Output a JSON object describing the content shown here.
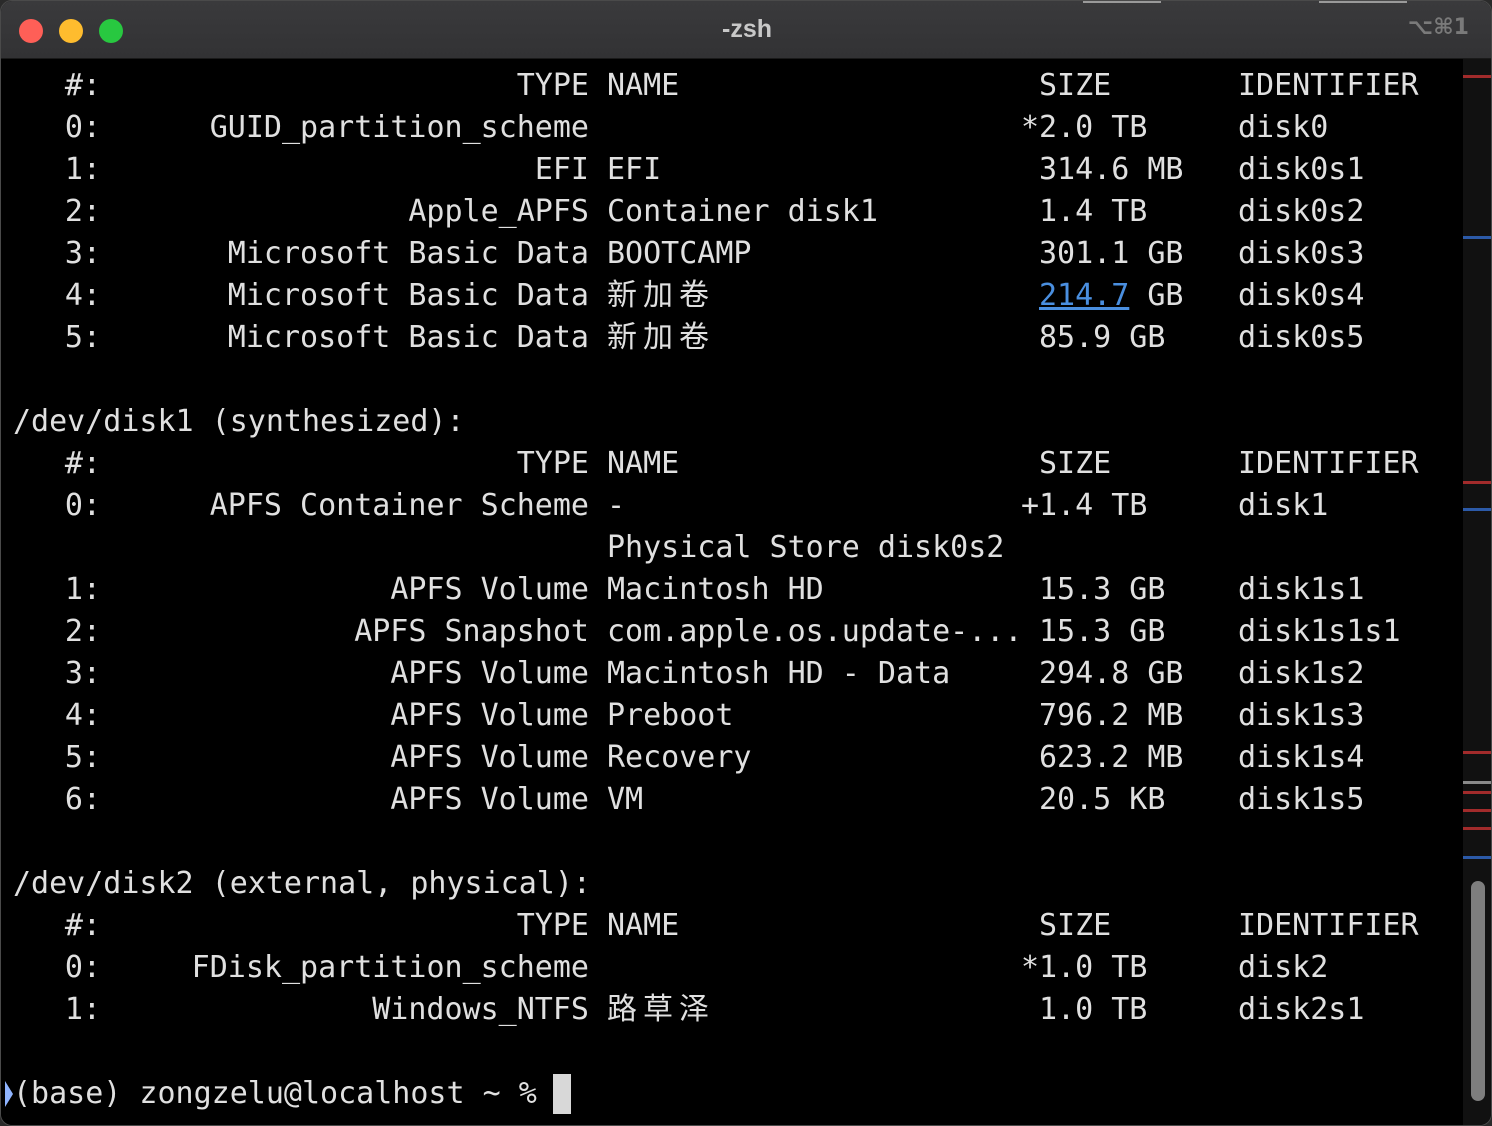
{
  "window": {
    "title": "-zsh",
    "shortcut": "⌥⌘1"
  },
  "lines": [
    {
      "id": "disk0-header",
      "num": "#:",
      "type": "TYPE",
      "name": "NAME",
      "size": "SIZE",
      "identifier": "IDENTIFIER"
    },
    {
      "id": "disk0-row0",
      "num": "0:",
      "type": "GUID_partition_scheme",
      "name": "",
      "size": "*2.0 TB",
      "identifier": "disk0"
    },
    {
      "id": "disk0-row1",
      "num": "1:",
      "type": "EFI",
      "name": "EFI",
      "size": "314.6 MB",
      "identifier": "disk0s1"
    },
    {
      "id": "disk0-row2",
      "num": "2:",
      "type": "Apple_APFS",
      "name": "Container disk1",
      "size": "1.4 TB",
      "identifier": "disk0s2"
    },
    {
      "id": "disk0-row3",
      "num": "3:",
      "type": "Microsoft Basic Data",
      "name": "BOOTCAMP",
      "size": "301.1 GB",
      "identifier": "disk0s3"
    },
    {
      "id": "disk0-row4",
      "num": "4:",
      "type": "Microsoft Basic Data",
      "name": "新加卷",
      "size": "214.7 GB",
      "size_value": "214.7",
      "size_unit": "GB",
      "identifier": "disk0s4",
      "size_link": true
    },
    {
      "id": "disk0-row5",
      "num": "5:",
      "type": "Microsoft Basic Data",
      "name": "新加卷",
      "size": "85.9 GB",
      "identifier": "disk0s5"
    },
    {
      "id": "disk1-title",
      "text": "/dev/disk1 (synthesized):"
    },
    {
      "id": "disk1-header",
      "num": "#:",
      "type": "TYPE",
      "name": "NAME",
      "size": "SIZE",
      "identifier": "IDENTIFIER"
    },
    {
      "id": "disk1-row0",
      "num": "0:",
      "type": "APFS Container Scheme",
      "name": "-",
      "size": "+1.4 TB",
      "identifier": "disk1"
    },
    {
      "id": "disk1-row0b",
      "num": "",
      "type": "",
      "name": "Physical Store disk0s2",
      "size": "",
      "identifier": ""
    },
    {
      "id": "disk1-row1",
      "num": "1:",
      "type": "APFS Volume",
      "name": "Macintosh HD",
      "size": "15.3 GB",
      "identifier": "disk1s1"
    },
    {
      "id": "disk1-row2",
      "num": "2:",
      "type": "APFS Snapshot",
      "name": "com.apple.os.update-...",
      "size": "15.3 GB",
      "identifier": "disk1s1s1"
    },
    {
      "id": "disk1-row3",
      "num": "3:",
      "type": "APFS Volume",
      "name": "Macintosh HD - Data",
      "size": "294.8 GB",
      "identifier": "disk1s2"
    },
    {
      "id": "disk1-row4",
      "num": "4:",
      "type": "APFS Volume",
      "name": "Preboot",
      "size": "796.2 MB",
      "identifier": "disk1s3"
    },
    {
      "id": "disk1-row5",
      "num": "5:",
      "type": "APFS Volume",
      "name": "Recovery",
      "size": "623.2 MB",
      "identifier": "disk1s4"
    },
    {
      "id": "disk1-row6",
      "num": "6:",
      "type": "APFS Volume",
      "name": "VM",
      "size": "20.5 KB",
      "identifier": "disk1s5"
    },
    {
      "id": "disk2-title",
      "text": "/dev/disk2 (external, physical):"
    },
    {
      "id": "disk2-header",
      "num": "#:",
      "type": "TYPE",
      "name": "NAME",
      "size": "SIZE",
      "identifier": "IDENTIFIER"
    },
    {
      "id": "disk2-row0",
      "num": "0:",
      "type": "FDisk_partition_scheme",
      "name": "",
      "size": "*1.0 TB",
      "identifier": "disk2"
    },
    {
      "id": "disk2-row1",
      "num": "1:",
      "type": "Windows_NTFS",
      "name": "路草泽",
      "size": "1.0 TB",
      "identifier": "disk2s1"
    }
  ],
  "prompt": {
    "text": "(base) zongzelu@localhost ~ %"
  },
  "colors": {
    "background": "#000000",
    "foreground": "#e0e0e0",
    "link": "#4a8fe0",
    "titlebar": "#363638",
    "close": "#fe5f57",
    "minimize": "#febc2e",
    "maximize": "#28c840"
  }
}
